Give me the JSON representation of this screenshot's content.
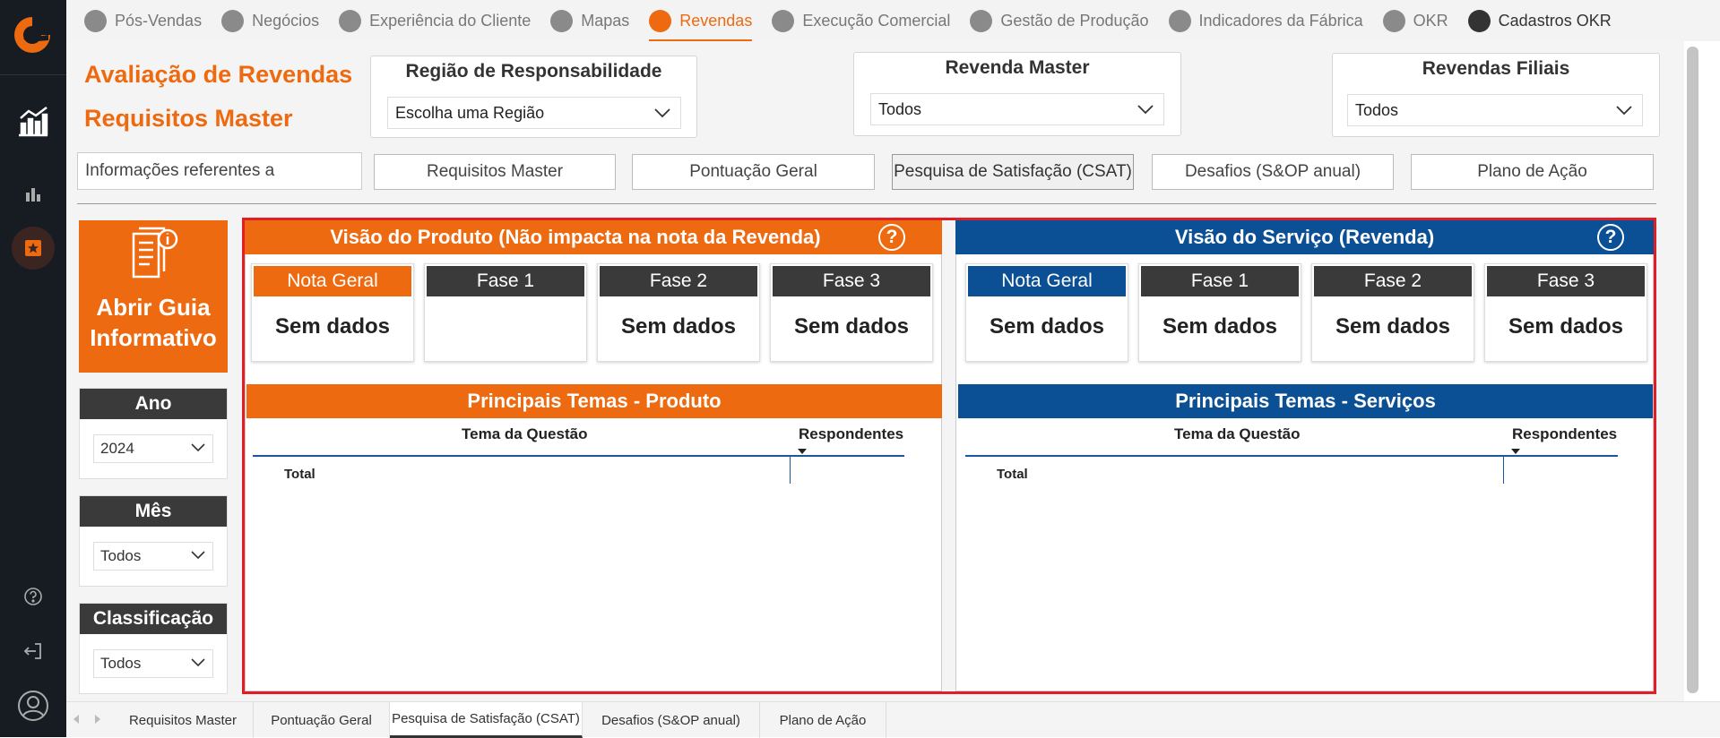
{
  "colors": {
    "accent": "#ee6a10",
    "navy": "#0b4f95",
    "dark": "#3a3a3a",
    "red_frame": "#e11d26",
    "sidebar": "#161c22"
  },
  "nav": {
    "items": [
      {
        "label": "Pós-Vendas",
        "icon": "person-badge-icon"
      },
      {
        "label": "Negócios",
        "icon": "handshake-icon"
      },
      {
        "label": "Experiência do Cliente",
        "icon": "customer-icon"
      },
      {
        "label": "Mapas",
        "icon": "map-person-icon"
      },
      {
        "label": "Revendas",
        "icon": "store-icon"
      },
      {
        "label": "Execução Comercial",
        "icon": "clock-chart-icon"
      },
      {
        "label": "Gestão de Produção",
        "icon": "production-icon"
      },
      {
        "label": "Indicadores da Fábrica",
        "icon": "factory-icon"
      },
      {
        "label": "OKR",
        "icon": "target-icon"
      },
      {
        "label": "Cadastros OKR",
        "icon": "user-icon"
      }
    ]
  },
  "page": {
    "title1": "Avaliação de Revendas",
    "title2": "Requisitos Master"
  },
  "filters": {
    "regiao": {
      "label": "Região de Responsabilidade",
      "value": "Escolha uma Região"
    },
    "master": {
      "label": "Revenda Master",
      "value": "Todos"
    },
    "filiais": {
      "label": "Revendas Filiais",
      "value": "Todos"
    }
  },
  "info_label": "Informações referentes a",
  "tabs": [
    "Requisitos Master",
    "Pontuação Geral",
    "Pesquisa de Satisfação (CSAT)",
    "Desafios (S&OP anual)",
    "Plano de Ação"
  ],
  "guide": {
    "line1": "Abrir Guia",
    "line2": "Informativo"
  },
  "left": {
    "ano": {
      "label": "Ano",
      "value": "2024"
    },
    "mes": {
      "label": "Mês",
      "value": "Todos"
    },
    "classificacao": {
      "label": "Classificação",
      "value": "Todos"
    }
  },
  "produto": {
    "title": "Visão do Produto (Não impacta na nota da Revenda)",
    "help": "?",
    "cards": [
      {
        "label": "Nota Geral",
        "value": "Sem dados"
      },
      {
        "label": "Fase 1",
        "value": ""
      },
      {
        "label": "Fase 2",
        "value": "Sem dados"
      },
      {
        "label": "Fase 3",
        "value": "Sem dados"
      }
    ],
    "themes_title": "Principais Temas - Produto",
    "col1": "Tema da Questão",
    "col2": "Respondentes",
    "total": "Total"
  },
  "servico": {
    "title": "Visão do Serviço (Revenda)",
    "help": "?",
    "cards": [
      {
        "label": "Nota Geral",
        "value": "Sem dados"
      },
      {
        "label": "Fase 1",
        "value": "Sem dados"
      },
      {
        "label": "Fase 2",
        "value": "Sem dados"
      },
      {
        "label": "Fase 3",
        "value": "Sem dados"
      }
    ],
    "themes_title": "Principais Temas - Serviços",
    "col1": "Tema da Questão",
    "col2": "Respondentes",
    "total": "Total"
  },
  "bottom_tabs": [
    "Requisitos Master",
    "Pontuação Geral",
    "Pesquisa de Satisfação (CSAT)",
    "Desafios (S&OP anual)",
    "Plano de Ação"
  ]
}
